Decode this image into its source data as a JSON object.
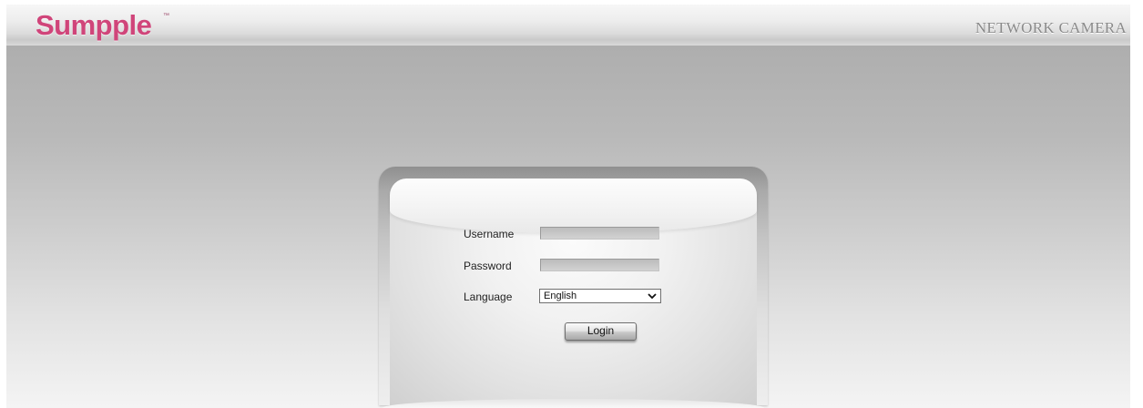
{
  "header": {
    "logo_text": "Sumpple",
    "logo_tm": "™",
    "product_name": "NETWORK CAMERA",
    "brand_color": "#d0457a"
  },
  "login": {
    "username_label": "Username",
    "username_value": "",
    "password_label": "Password",
    "password_value": "",
    "language_label": "Language",
    "language_selected": "English",
    "login_button_label": "Login"
  },
  "icons": {
    "dropdown": "chevron-down-icon"
  }
}
